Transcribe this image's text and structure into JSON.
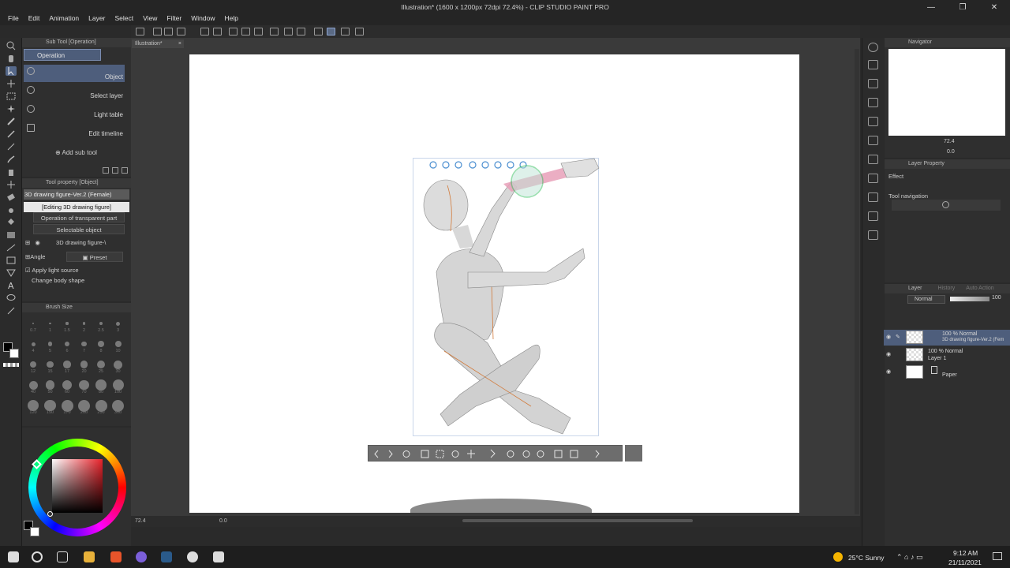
{
  "window": {
    "title": "Illustration* (1600 x 1200px 72dpi 72.4%) - CLIP STUDIO PAINT PRO",
    "minimize": "—",
    "maximize": "❐",
    "close": "✕"
  },
  "menu": [
    "File",
    "Edit",
    "Animation",
    "Layer",
    "Select",
    "View",
    "Filter",
    "Window",
    "Help"
  ],
  "subtool": {
    "panel_title": "Sub Tool [Operation]",
    "tab": "Operation",
    "items": [
      {
        "label": "Object",
        "icon": "object-arrow-icon",
        "selected": true
      },
      {
        "label": "Select layer",
        "icon": "select-layer-icon",
        "selected": false
      },
      {
        "label": "Light table",
        "icon": "light-table-icon",
        "selected": false
      },
      {
        "label": "Edit timeline",
        "icon": "timeline-icon",
        "selected": false
      }
    ],
    "add_sub_tool": "Add sub tool"
  },
  "toolprop": {
    "panel_title": "Tool property [Object]",
    "figure_name": "3D drawing figure-Ver.2 (Female)",
    "editing": "[Editing 3D drawing figure]",
    "transparent_op": "Operation of transparent part",
    "selectable": "Selectable object",
    "object_name": "3D drawing figure-\\",
    "angle": "Angle",
    "preset": "Preset",
    "apply_light": "Apply light source",
    "change_body": "Change body shape"
  },
  "brush": {
    "panel_title": "Brush Size",
    "sizes": [
      "0.7",
      "1",
      "1.5",
      "2",
      "2.5",
      "3",
      "4",
      "5",
      "6",
      "7",
      "8",
      "10",
      "12",
      "15",
      "17",
      "20",
      "25",
      "30",
      "40",
      "50",
      "60",
      "70",
      "80",
      "100",
      "120",
      "150",
      "170",
      "200",
      "250",
      "300"
    ]
  },
  "canvas": {
    "doc_tab": "Illustration*",
    "zoom": "72.4",
    "rotation": "0.0"
  },
  "navigator": {
    "title": "Navigator",
    "zoom": "72.4",
    "rotation": "0.0"
  },
  "layer_property": {
    "title": "Layer Property",
    "effect": "Effect",
    "tool_navigation": "Tool navigation"
  },
  "layers": {
    "tab": "Layer",
    "tab2": "History",
    "tab3": "Auto Action",
    "blend_mode": "Normal",
    "opacity": "100",
    "rows": [
      {
        "mode": "100 % Normal",
        "name": "3D drawing figure-Ver.2 (Fem",
        "selected": true
      },
      {
        "mode": "100 % Normal",
        "name": "Layer 1",
        "selected": false
      },
      {
        "mode": "",
        "name": "Paper",
        "selected": false
      }
    ]
  },
  "taskbar": {
    "weather": "25°C  Sunny",
    "time": "9:12 AM",
    "date": "21/11/2021"
  },
  "colors": {
    "accent": "#4e5e7c",
    "main_color": "#000000",
    "sub_color": "#ffffff"
  }
}
